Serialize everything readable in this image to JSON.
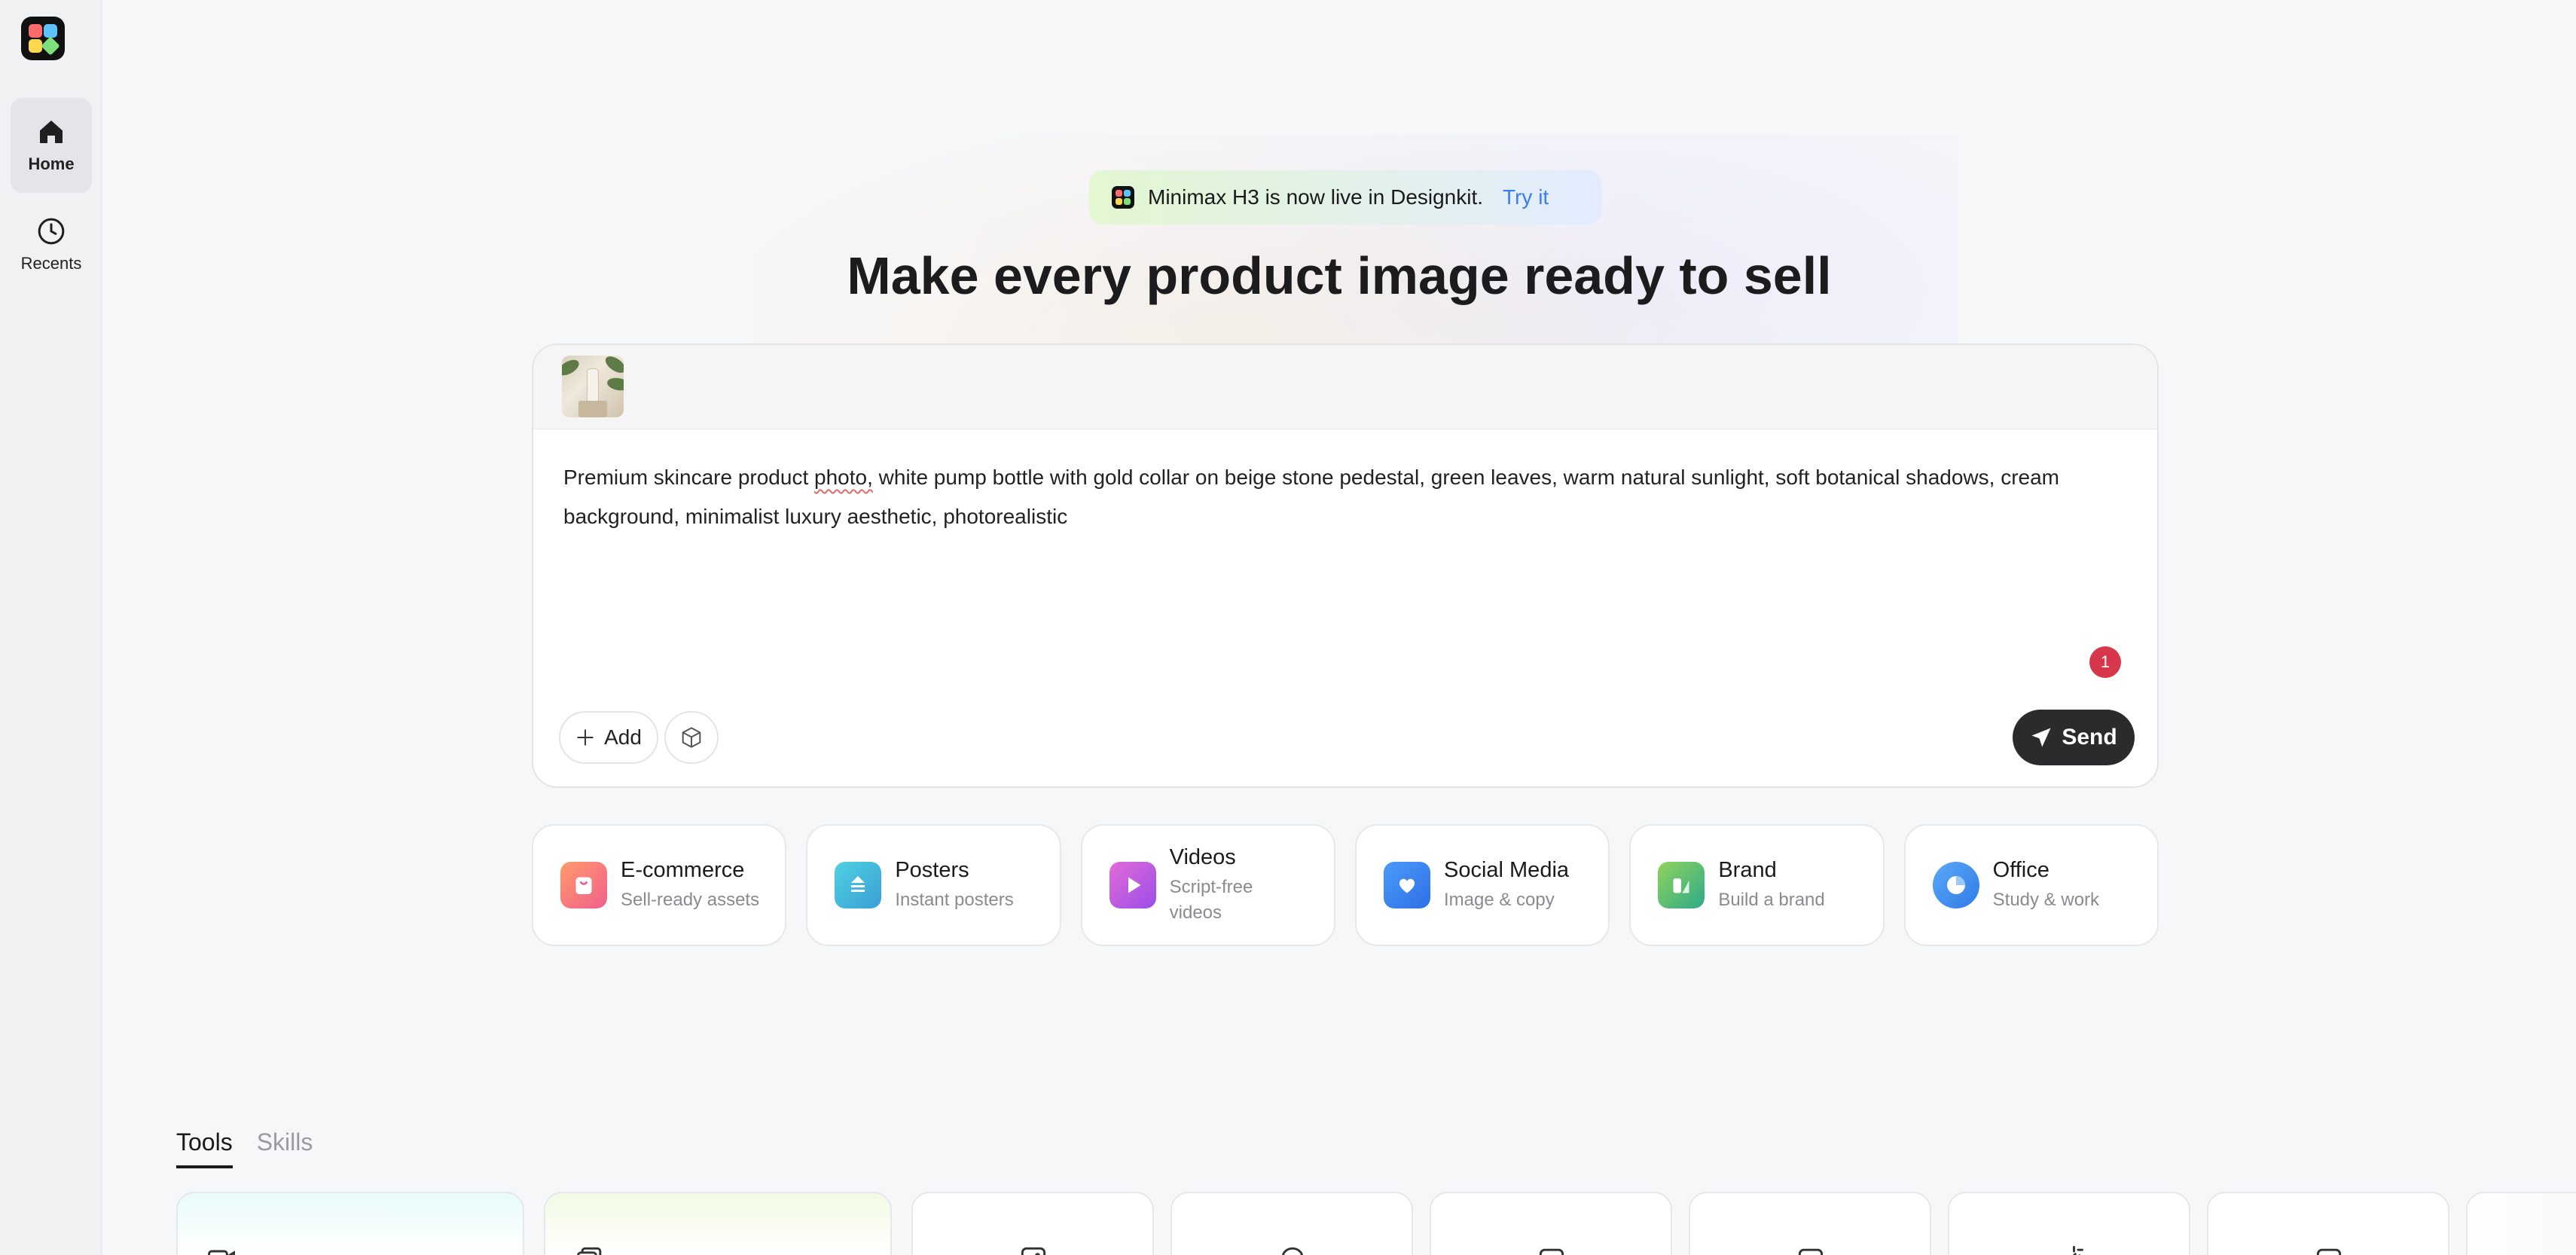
{
  "sidebar": {
    "logo_colors": [
      "#ff6b6b",
      "#5ec2ff",
      "#ffd84d",
      "#7ee07a"
    ],
    "items": [
      {
        "label": "Home",
        "icon": "home-icon",
        "active": true
      },
      {
        "label": "Recents",
        "icon": "clock-icon",
        "active": false
      }
    ]
  },
  "banner": {
    "text": "Minimax H3 is now live in Designkit.",
    "link": "Try it"
  },
  "headline": "Make every product image ready to sell",
  "composer": {
    "prompt_before": "Premium skincare product ",
    "prompt_flagged": "photo,",
    "prompt_after": " white pump bottle with gold collar on beige stone pedestal, green leaves, warm natural sunlight, soft botanical shadows, cream background, minimalist luxury aesthetic, photorealistic",
    "badge_count": "1",
    "add_label": "Add",
    "send_label": "Send",
    "accent_dark": "#2b2b2d",
    "badge_color": "#d7374a"
  },
  "categories": [
    {
      "title": "E-commerce",
      "subtitle": "Sell-ready assets",
      "icon": "shopping-bag-icon",
      "color": "#f4826b"
    },
    {
      "title": "Posters",
      "subtitle": "Instant posters",
      "icon": "poster-icon",
      "color": "#3fb8d8"
    },
    {
      "title": "Videos",
      "subtitle": "Script-free videos",
      "icon": "play-icon",
      "color": "#c35be8"
    },
    {
      "title": "Social Media",
      "subtitle": "Image & copy",
      "icon": "heart-chat-icon",
      "color": "#3d8bf5"
    },
    {
      "title": "Brand",
      "subtitle": "Build a brand",
      "icon": "brand-icon",
      "color": "#4fbf7a"
    },
    {
      "title": "Office",
      "subtitle": "Study & work",
      "icon": "pie-chart-icon",
      "color": "#3a8ff0"
    }
  ],
  "tabs": [
    {
      "label": "Tools",
      "active": true
    },
    {
      "label": "Skills",
      "active": false
    }
  ]
}
